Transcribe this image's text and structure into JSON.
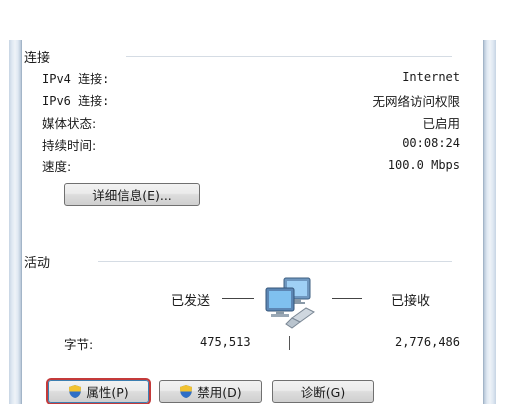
{
  "connection": {
    "title": "连接",
    "rows": [
      {
        "label": "IPv4 连接:",
        "value": "Internet"
      },
      {
        "label": "IPv6 连接:",
        "value": "无网络访问权限"
      },
      {
        "label": "媒体状态:",
        "value": "已启用"
      },
      {
        "label": "持续时间:",
        "value": "00:08:24"
      },
      {
        "label": "速度:",
        "value": "100.0 Mbps"
      }
    ],
    "details_button": "详细信息(E)..."
  },
  "activity": {
    "title": "活动",
    "sent_label": "已发送",
    "received_label": "已接收",
    "bytes_label": "字节:",
    "bytes_sent": "475,513",
    "bytes_received": "2,776,486",
    "icon": "network-computers-icon"
  },
  "buttons": {
    "properties": "属性(P)",
    "disable": "禁用(D)",
    "diagnose": "诊断(G)"
  },
  "colors": {
    "focus_ring": "#c43a3a",
    "frame": "#b7c7d8"
  }
}
